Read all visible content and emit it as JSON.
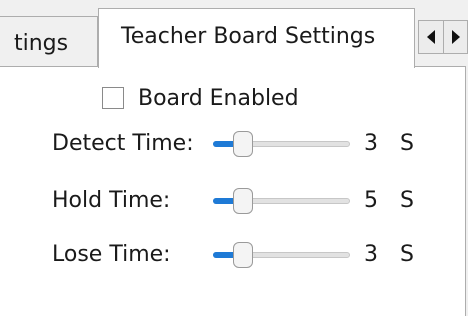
{
  "tabs": [
    {
      "label": "tings",
      "active": false
    },
    {
      "label": "Teacher Board Settings",
      "active": true
    }
  ],
  "tab_scroll": {
    "left_icon": "triangle-left-icon",
    "right_icon": "triangle-right-icon"
  },
  "board_enabled": {
    "label": "Board Enabled",
    "checked": false
  },
  "sliders": [
    {
      "label": "Detect Time:",
      "value": "3",
      "unit": "S",
      "fraction": 0.22
    },
    {
      "label": "Hold Time:",
      "value": "5",
      "unit": "S",
      "fraction": 0.22
    },
    {
      "label": "Lose Time:",
      "value": "3",
      "unit": "S",
      "fraction": 0.22
    }
  ],
  "colors": {
    "accent": "#1e7ad6"
  }
}
